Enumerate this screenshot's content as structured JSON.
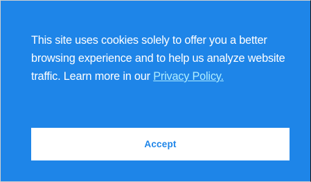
{
  "cookie_banner": {
    "message_text": "This site uses cookies solely to offer you a better browsing experience and to help us analyze website traffic. Learn more in our ",
    "policy_link_label": "Privacy Policy.",
    "accept_label": "Accept"
  },
  "colors": {
    "banner_background": "#1e85e8",
    "message_text": "#ffffff",
    "policy_link": "#aeedff",
    "accept_button_background": "#ffffff",
    "accept_button_text": "#1e85e8"
  }
}
